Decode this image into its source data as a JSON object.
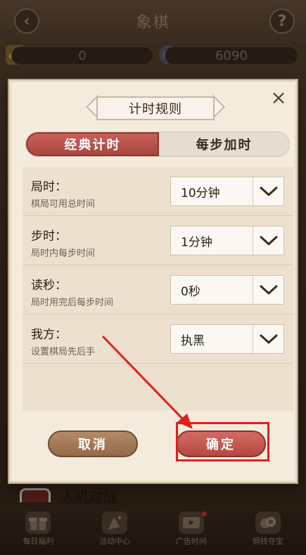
{
  "header": {
    "title": "象棋",
    "back_icon": "‹",
    "help_icon": "?"
  },
  "currency": {
    "gold_value": "0",
    "coin_value": "6090"
  },
  "background_list": {
    "item_label": "人机对战"
  },
  "bottom_nav": {
    "items": [
      {
        "label": "每日福利",
        "icon": "gift-icon"
      },
      {
        "label": "活动中心",
        "icon": "party-icon"
      },
      {
        "label": "广告时间",
        "icon": "tv-icon"
      },
      {
        "label": "铜钱夺宝",
        "icon": "coins-icon"
      }
    ]
  },
  "dialog": {
    "title": "计时规则",
    "close_label": "×",
    "tabs": [
      {
        "label": "经典计时",
        "active": true
      },
      {
        "label": "每步加时",
        "active": false
      }
    ],
    "rules": [
      {
        "title": "局时：",
        "subtitle": "棋局可用总时间",
        "value": "10分钟"
      },
      {
        "title": "步时：",
        "subtitle": "局时内每步时间",
        "value": "1分钟"
      },
      {
        "title": "读秒：",
        "subtitle": "局时用完后每步时间",
        "value": "0秒"
      },
      {
        "title": "我方：",
        "subtitle": "设置棋局先后手",
        "value": "执黑"
      }
    ],
    "cancel_label": "取消",
    "confirm_label": "确定"
  },
  "colors": {
    "accent_red": "#b14a42",
    "annotation_red": "#e0201a",
    "dialog_bg": "#f4ebdd"
  }
}
